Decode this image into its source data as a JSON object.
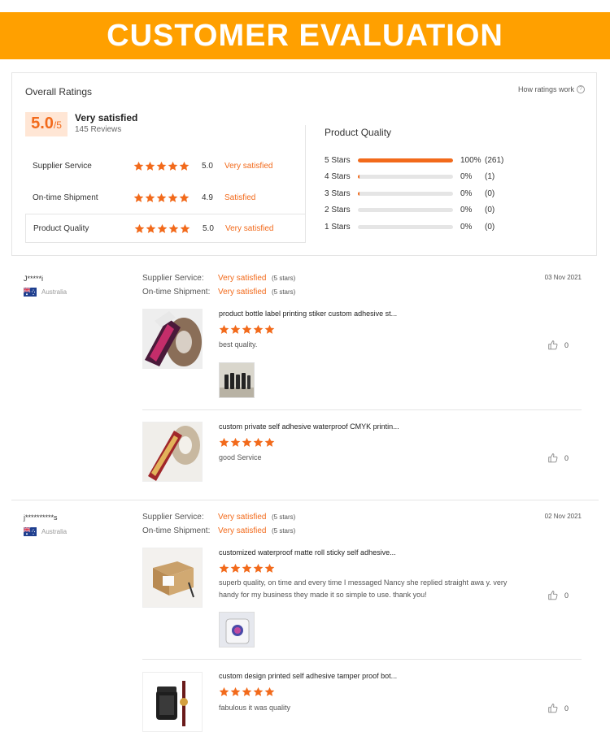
{
  "banner": {
    "title": "CUSTOMER EVALUATION"
  },
  "overall": {
    "title": "Overall Ratings",
    "how_link": "How ratings work",
    "help_glyph": "?",
    "score": "5.0",
    "score_max": "/5",
    "desc": "Very satisfied",
    "reviews": "145 Reviews",
    "accent": "#F26A1B",
    "metrics": [
      {
        "label": "Supplier Service",
        "value": "5.0",
        "word": "Very satisfied"
      },
      {
        "label": "On-time Shipment",
        "value": "4.9",
        "word": "Satisfied"
      },
      {
        "label": "Product Quality",
        "value": "5.0",
        "word": "Very satisfied"
      }
    ]
  },
  "product_quality": {
    "title": "Product Quality",
    "rows": [
      {
        "label": "5 Stars",
        "pct": "100%",
        "count": "(261)",
        "fraction": 1.0
      },
      {
        "label": "4 Stars",
        "pct": "0%",
        "count": "(1)",
        "fraction": 0.02
      },
      {
        "label": "3 Stars",
        "pct": "0%",
        "count": "(0)",
        "fraction": 0.02
      },
      {
        "label": "2 Stars",
        "pct": "0%",
        "count": "(0)",
        "fraction": 0
      },
      {
        "label": "1 Stars",
        "pct": "0%",
        "count": "(0)",
        "fraction": 0
      }
    ]
  },
  "reviews": [
    {
      "name": "J*****i",
      "country": "Australia",
      "date": "03 Nov 2021",
      "supplier_label": "Supplier Service:",
      "supplier_word": "Very satisfied",
      "supplier_stars": "(5 stars)",
      "shipment_label": "On-time Shipment:",
      "shipment_word": "Very satisfied",
      "shipment_stars": "(5 stars)",
      "items": [
        {
          "title": "product bottle label printing stiker custom adhesive st...",
          "text": "best quality.",
          "likes": "0",
          "rating": 5
        },
        {
          "title": "custom private self adhesive waterproof CMYK printin...",
          "text": "good Service",
          "likes": "0",
          "rating": 5
        }
      ]
    },
    {
      "name": "j**********s",
      "country": "Australia",
      "date": "02 Nov 2021",
      "supplier_label": "Supplier Service:",
      "supplier_word": "Very satisfied",
      "supplier_stars": "(5 stars)",
      "shipment_label": "On-time Shipment:",
      "shipment_word": "Very satisfied",
      "shipment_stars": "(5 stars)",
      "items": [
        {
          "title": "customized waterproof matte roll sticky self adhesive...",
          "text": "superb quality, on time and every time I messaged Nancy she replied straight awa y. very handy for my business they made it so simple to use. thank you!",
          "likes": "0",
          "rating": 5
        },
        {
          "title": "custom design printed self adhesive tamper proof bot...",
          "text": "fabulous it was quality",
          "likes": "0",
          "rating": 5
        }
      ]
    }
  ]
}
